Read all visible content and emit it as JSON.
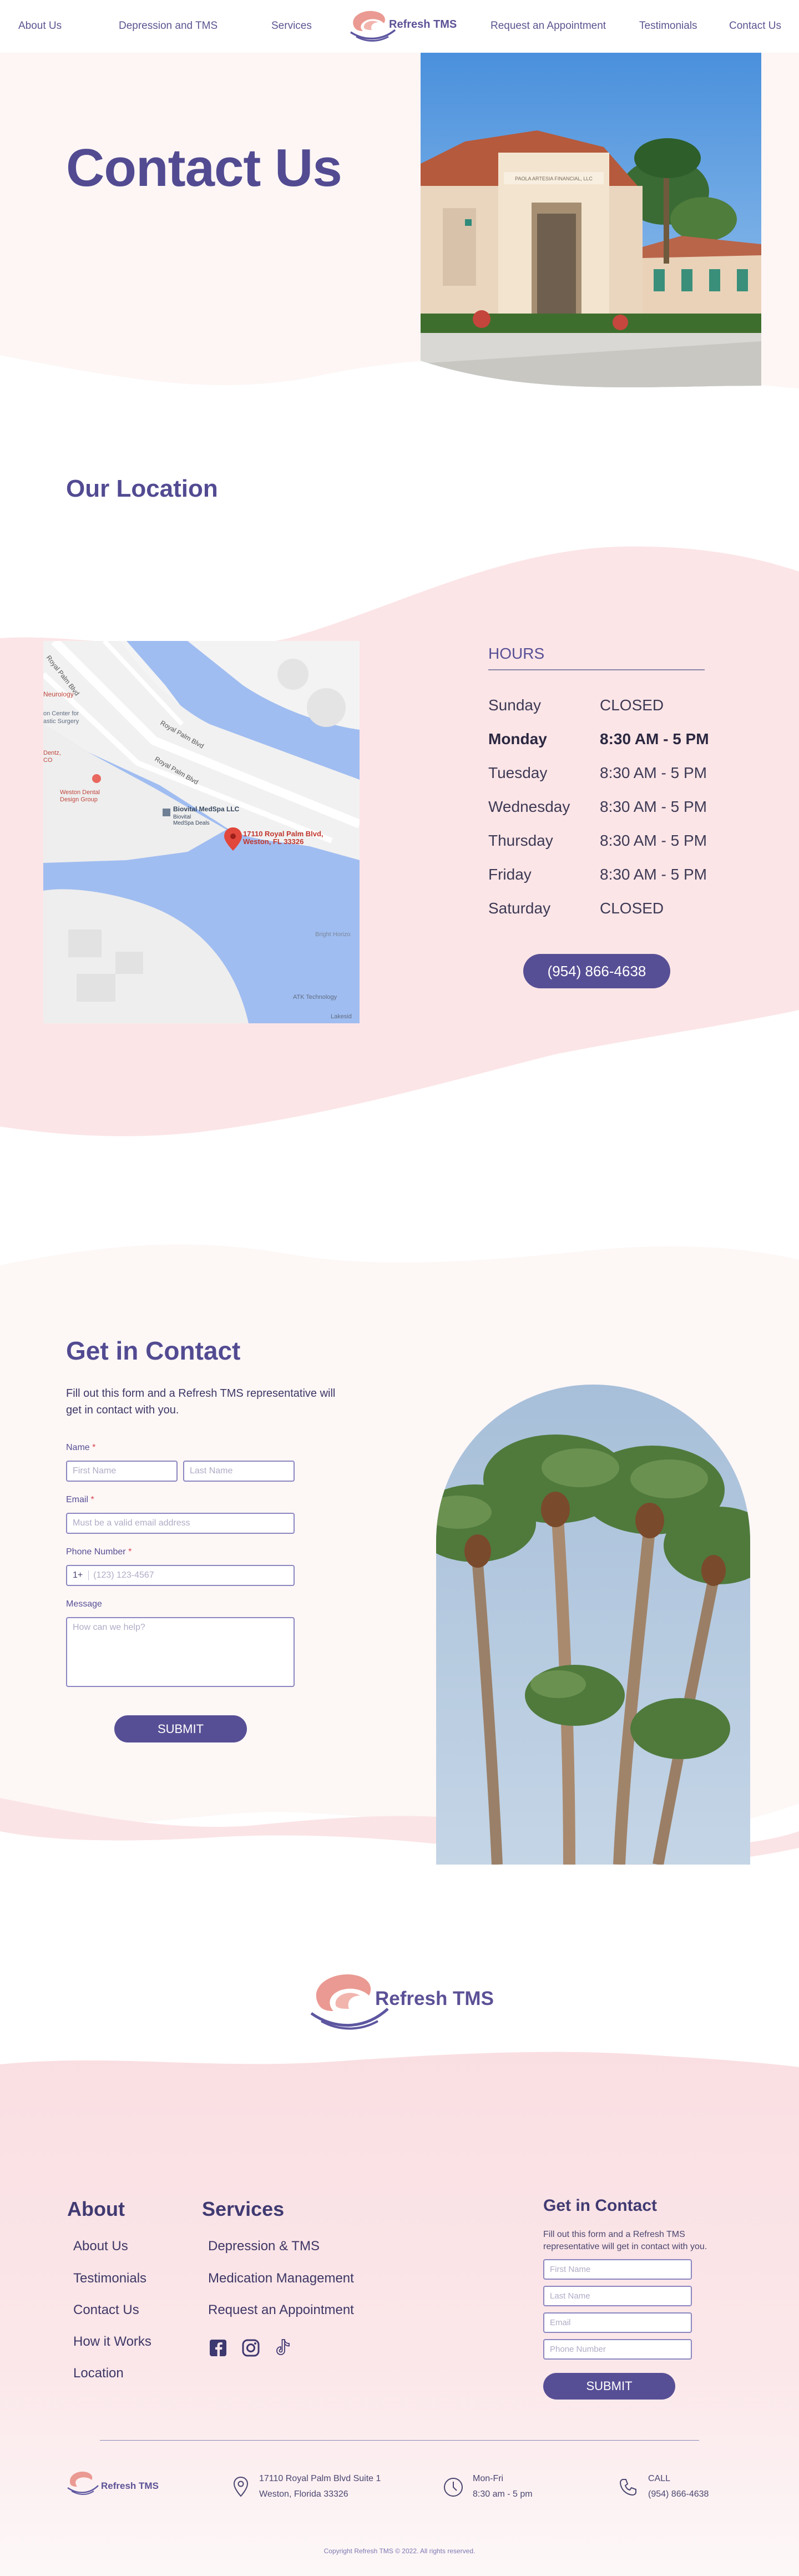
{
  "nav": {
    "left": [
      "About Us",
      "Depression and TMS",
      "Services"
    ],
    "right": [
      "Request an Appointment",
      "Testimonials",
      "Contact Us"
    ],
    "brand": "Refresh TMS"
  },
  "hero": {
    "title": "Contact Us",
    "building_sign": "PAOLA ARTESIA FINANCIAL, LLC"
  },
  "location": {
    "title": "Our Location",
    "map_labels": {
      "road1": "Royal Palm Blvd",
      "road2": "Royal Palm Blvd",
      "road3": "Royal Palm Blvd",
      "neuro": "Neurology",
      "surgery": "on Center for\nastic Surgery",
      "dental": "Weston Dental\nDesign Group",
      "dentz": "Dentz,\nCO",
      "medspa": "Biovital MedSpa LLC",
      "medspa_sub": "Biovital\nMedSpa Deals",
      "pin": "17110 Royal Palm Blvd,\nWeston, FL 33326",
      "bright": "Bright Horizo",
      "atk": "ATK Technology",
      "lakeside": "Lakesid"
    },
    "hours_title": "HOURS",
    "hours": [
      {
        "day": "Sunday",
        "time": "CLOSED"
      },
      {
        "day": "Monday",
        "time": "8:30 AM - 5 PM"
      },
      {
        "day": "Tuesday",
        "time": "8:30 AM - 5 PM"
      },
      {
        "day": "Wednesday",
        "time": "8:30 AM - 5 PM"
      },
      {
        "day": "Thursday",
        "time": "8:30 AM - 5 PM"
      },
      {
        "day": "Friday",
        "time": "8:30 AM - 5 PM"
      },
      {
        "day": "Saturday",
        "time": "CLOSED"
      }
    ],
    "phone_button": "(954) 866-4638"
  },
  "contact": {
    "title": "Get in Contact",
    "intro": "Fill out this form and a Refresh TMS representative will get in contact with you.",
    "name_label": "Name",
    "first_placeholder": "First Name",
    "last_placeholder": "Last Name",
    "email_label": "Email",
    "email_placeholder": "Must be a valid email address",
    "phone_label": "Phone Number",
    "phone_prefix": "1+",
    "phone_placeholder": "(123) 123-4567",
    "message_label": "Message",
    "message_placeholder": "How can we help?",
    "required_mark": "*",
    "submit": "SUBMIT"
  },
  "footer": {
    "brand": "Refresh TMS",
    "about_title": "About",
    "about_links": [
      "About Us",
      "Testimonials",
      "Contact Us",
      "How it Works",
      "Location"
    ],
    "services_title": "Services",
    "services_links": [
      "Depression & TMS",
      "Medication Management",
      "Request an Appointment"
    ],
    "contact_title": "Get in Contact",
    "contact_intro": "Fill out this form and a Refresh TMS representative will get in contact with you.",
    "placeholders": [
      "First Name",
      "Last Name",
      "Email",
      "Phone Number"
    ],
    "submit": "SUBMIT",
    "address_line1": "17110 Royal Palm Blvd Suite 1",
    "address_line2": "Weston, Florida 33326",
    "hours_line1": "Mon-Fri",
    "hours_line2": "8:30 am - 5 pm",
    "call_line1": "CALL",
    "call_line2": "(954) 866-4638",
    "copyright": "Copyright Refresh TMS © 2022. All rights reserved."
  },
  "colors": {
    "primary": "#574f95",
    "pink": "#fbe1e3",
    "blush": "#fdf7f6",
    "accent": "#e98f8a"
  }
}
